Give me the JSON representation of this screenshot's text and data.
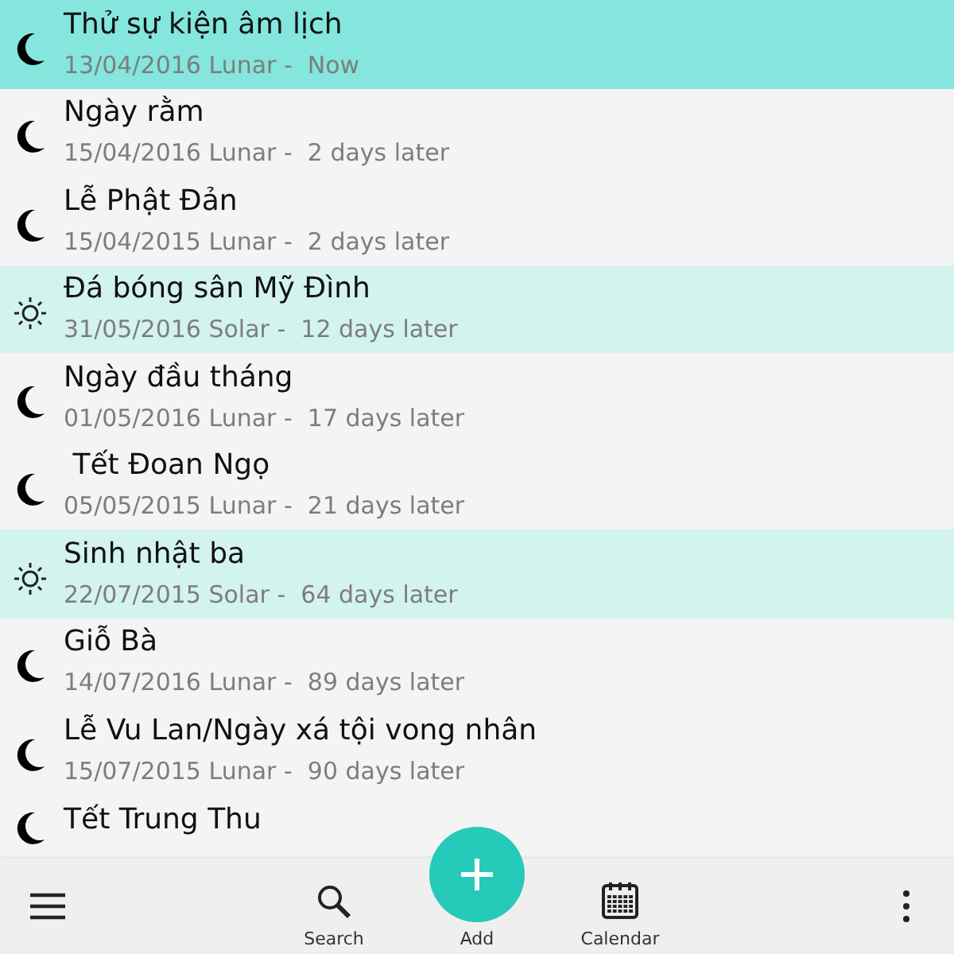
{
  "events": [
    {
      "title": "Thử sự kiện âm lịch",
      "detail": "13/04/2016 Lunar -  Now",
      "kind": "lunar",
      "selected": true
    },
    {
      "title": "Ngày rằm",
      "detail": "15/04/2016 Lunar -  2 days later",
      "kind": "lunar",
      "selected": false
    },
    {
      "title": "Lễ Phật Đản",
      "detail": "15/04/2015 Lunar -  2 days later",
      "kind": "lunar",
      "selected": false
    },
    {
      "title": "Đá bóng sân Mỹ Đình",
      "detail": "31/05/2016 Solar -  12 days later",
      "kind": "solar",
      "selected": false
    },
    {
      "title": "Ngày đầu tháng",
      "detail": "01/05/2016 Lunar -  17 days later",
      "kind": "lunar",
      "selected": false
    },
    {
      "title": " Tết Đoan Ngọ",
      "detail": "05/05/2015 Lunar -  21 days later",
      "kind": "lunar",
      "selected": false
    },
    {
      "title": "Sinh nhật ba",
      "detail": "22/07/2015 Solar -  64 days later",
      "kind": "solar",
      "selected": false
    },
    {
      "title": "Giỗ Bà",
      "detail": "14/07/2016 Lunar -  89 days later",
      "kind": "lunar",
      "selected": false
    },
    {
      "title": "Lễ Vu Lan/Ngày xá tội vong nhân",
      "detail": "15/07/2015 Lunar -  90 days later",
      "kind": "lunar",
      "selected": false
    },
    {
      "title": "Tết Trung Thu",
      "kind": "lunar",
      "selected": false
    }
  ],
  "toolbar": {
    "actions": [
      {
        "label": "Search",
        "kind": "search"
      },
      {
        "label": "Add",
        "kind": "add"
      },
      {
        "label": "Calendar",
        "kind": "calendar"
      }
    ]
  }
}
